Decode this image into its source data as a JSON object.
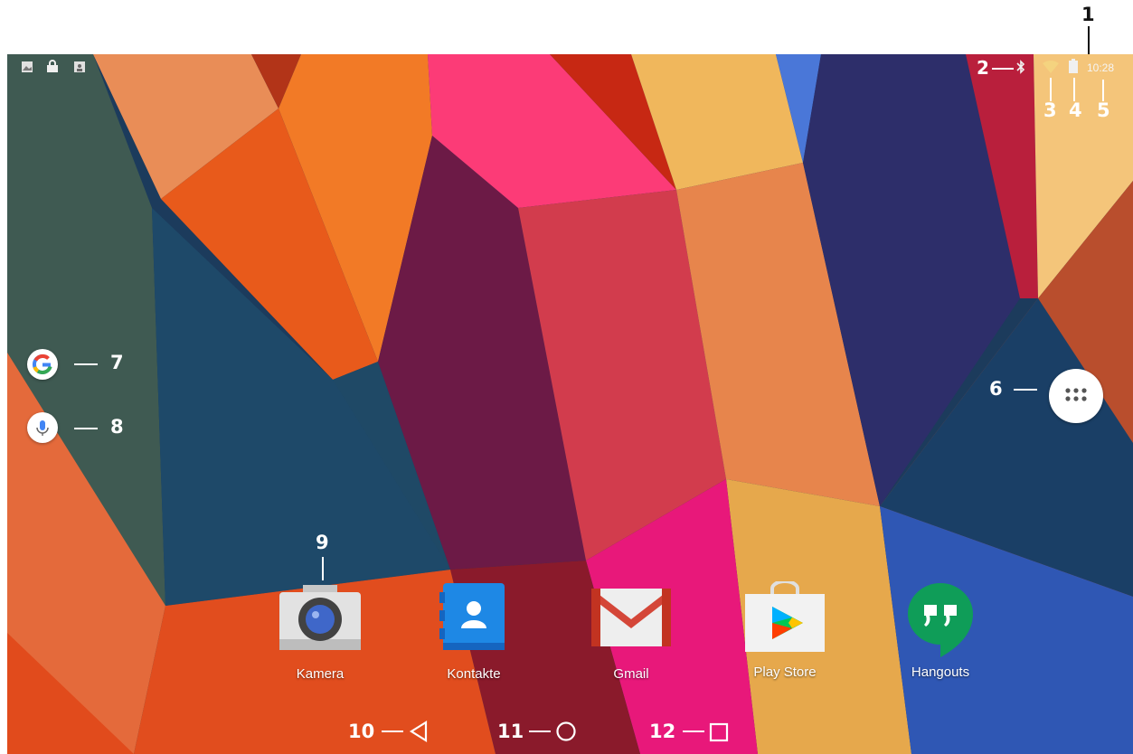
{
  "status_bar": {
    "left_icons": [
      "image-icon",
      "lock-icon",
      "portrait-icon"
    ],
    "right_icons": [
      "bluetooth-icon",
      "wifi-icon",
      "battery-icon"
    ],
    "time": "10:28"
  },
  "side_buttons": {
    "google_search": "google-g-icon",
    "voice_search": "microphone-icon",
    "app_drawer": "app-drawer-icon"
  },
  "dock": [
    {
      "label": "Kamera",
      "icon": "camera-icon"
    },
    {
      "label": "Kontakte",
      "icon": "contacts-icon"
    },
    {
      "label": "Gmail",
      "icon": "gmail-icon"
    },
    {
      "label": "Play Store",
      "icon": "play-store-icon"
    },
    {
      "label": "Hangouts",
      "icon": "hangouts-icon"
    }
  ],
  "nav_bar": [
    "back-icon",
    "home-icon",
    "recents-icon"
  ],
  "callouts": {
    "c1": "1",
    "c2": "2",
    "c3": "3",
    "c4": "4",
    "c5": "5",
    "c6": "6",
    "c7": "7",
    "c8": "8",
    "c9": "9",
    "c10": "10",
    "c11": "11",
    "c12": "12"
  },
  "colors": {
    "gmail_red": "#d44638",
    "hangouts_green": "#0f9d58",
    "contacts_blue": "#1e88e5",
    "play_green": "#00c853"
  }
}
